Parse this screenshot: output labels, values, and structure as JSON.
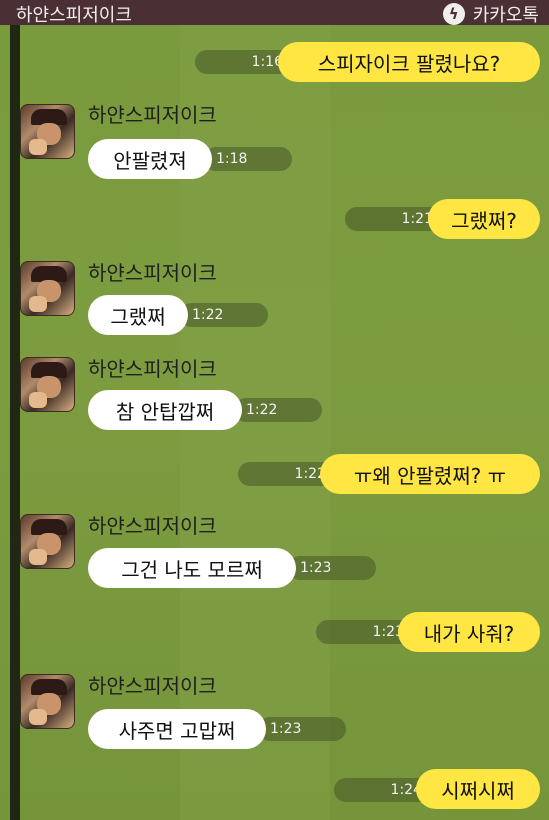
{
  "topbar": {
    "title": "하얀스피저이크",
    "brand_label": "카카오톡"
  },
  "messages": [
    {
      "type": "out",
      "text": "스피자이크 팔렸나요?",
      "time": "1:16"
    },
    {
      "type": "in",
      "sender": "하얀스피저이크",
      "text": "안팔렸져",
      "time": "1:18"
    },
    {
      "type": "out",
      "text": "그랬쩌?",
      "time": "1:21"
    },
    {
      "type": "in",
      "sender": "하얀스피저이크",
      "text": "그랬쩌",
      "time": "1:22"
    },
    {
      "type": "in",
      "sender": "하얀스피저이크",
      "text": "참 안탑깝쩌",
      "time": "1:22"
    },
    {
      "type": "out",
      "text": "ㅠ왜 안팔렸쩌? ㅠ",
      "time": "1:22"
    },
    {
      "type": "in",
      "sender": "하얀스피저이크",
      "text": "그건 나도 모르쩌",
      "time": "1:23"
    },
    {
      "type": "out",
      "text": "내가 사줘?",
      "time": "1:23"
    },
    {
      "type": "in",
      "sender": "하얀스피저이크",
      "text": "사주면 고맙쩌",
      "time": "1:23"
    },
    {
      "type": "out",
      "text": "시쩌시쩌",
      "time": "1:24"
    }
  ],
  "colors": {
    "topbar": "#4a2f35",
    "background": "#7a9a3e",
    "outgoing_bubble": "#ffe642",
    "incoming_bubble": "#ffffff"
  },
  "icons": {
    "brand": "kakaotalk-icon"
  }
}
